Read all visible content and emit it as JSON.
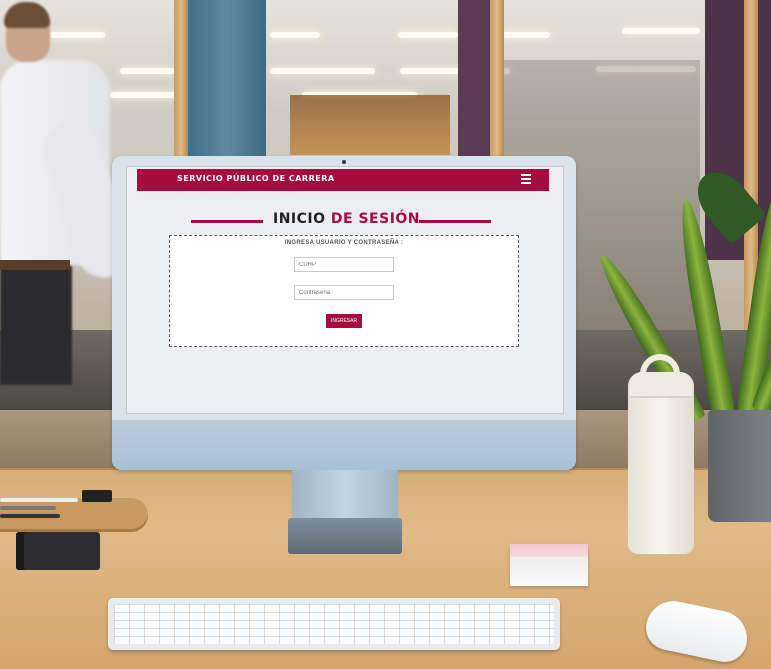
{
  "site": {
    "brand": "SERVICIO PÚBLICO DE CARRERA",
    "title_part1": "INICIO",
    "title_part2": "DE SESIÓN",
    "instructions": "INGRESA USUARIO Y CONTRASEÑA :",
    "curp_placeholder": "CURP",
    "password_placeholder": "Contraseña",
    "submit_label": "INGRESAR"
  },
  "colors": {
    "brand_crimson": "#a50d3e"
  },
  "icons": {
    "menu": "hamburger-menu-icon"
  }
}
